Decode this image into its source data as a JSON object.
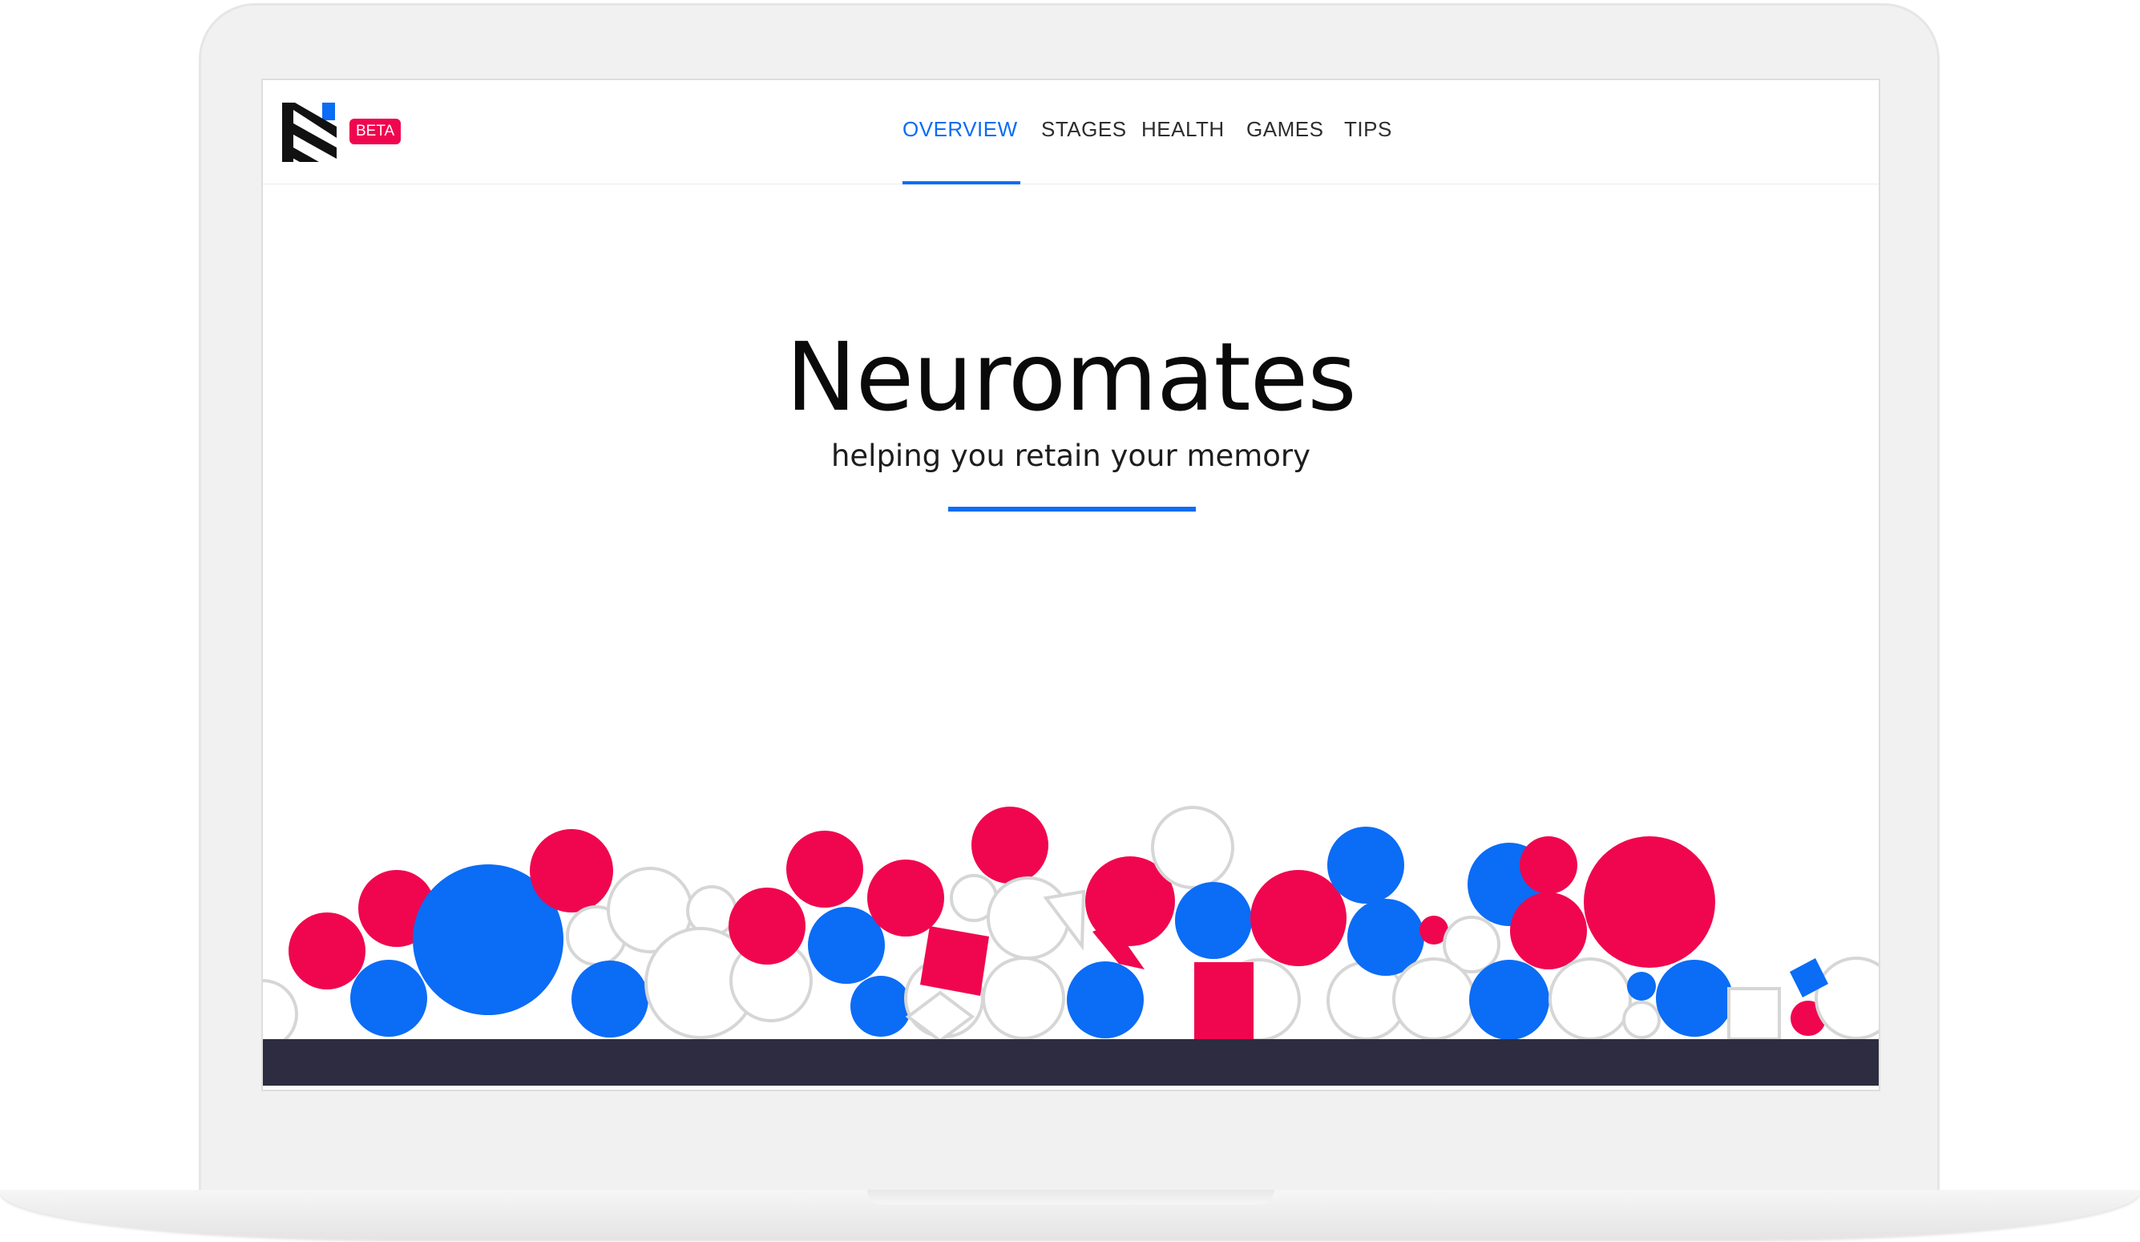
{
  "brand": {
    "logo_icon": "neuromates-n-logo",
    "badge": "BETA"
  },
  "nav": {
    "items": [
      {
        "label": "OVERVIEW",
        "active": true
      },
      {
        "label": "STAGES",
        "active": false
      },
      {
        "label": "HEALTH",
        "active": false
      },
      {
        "label": "GAMES",
        "active": false
      },
      {
        "label": "TIPS",
        "active": false
      }
    ]
  },
  "hero": {
    "title": "Neuromates",
    "subtitle": "helping you retain your memory"
  },
  "colors": {
    "accent_blue": "#0b6cf5",
    "accent_red": "#f0064e",
    "ground": "#2e2c40",
    "outline": "#d6d6d6"
  }
}
